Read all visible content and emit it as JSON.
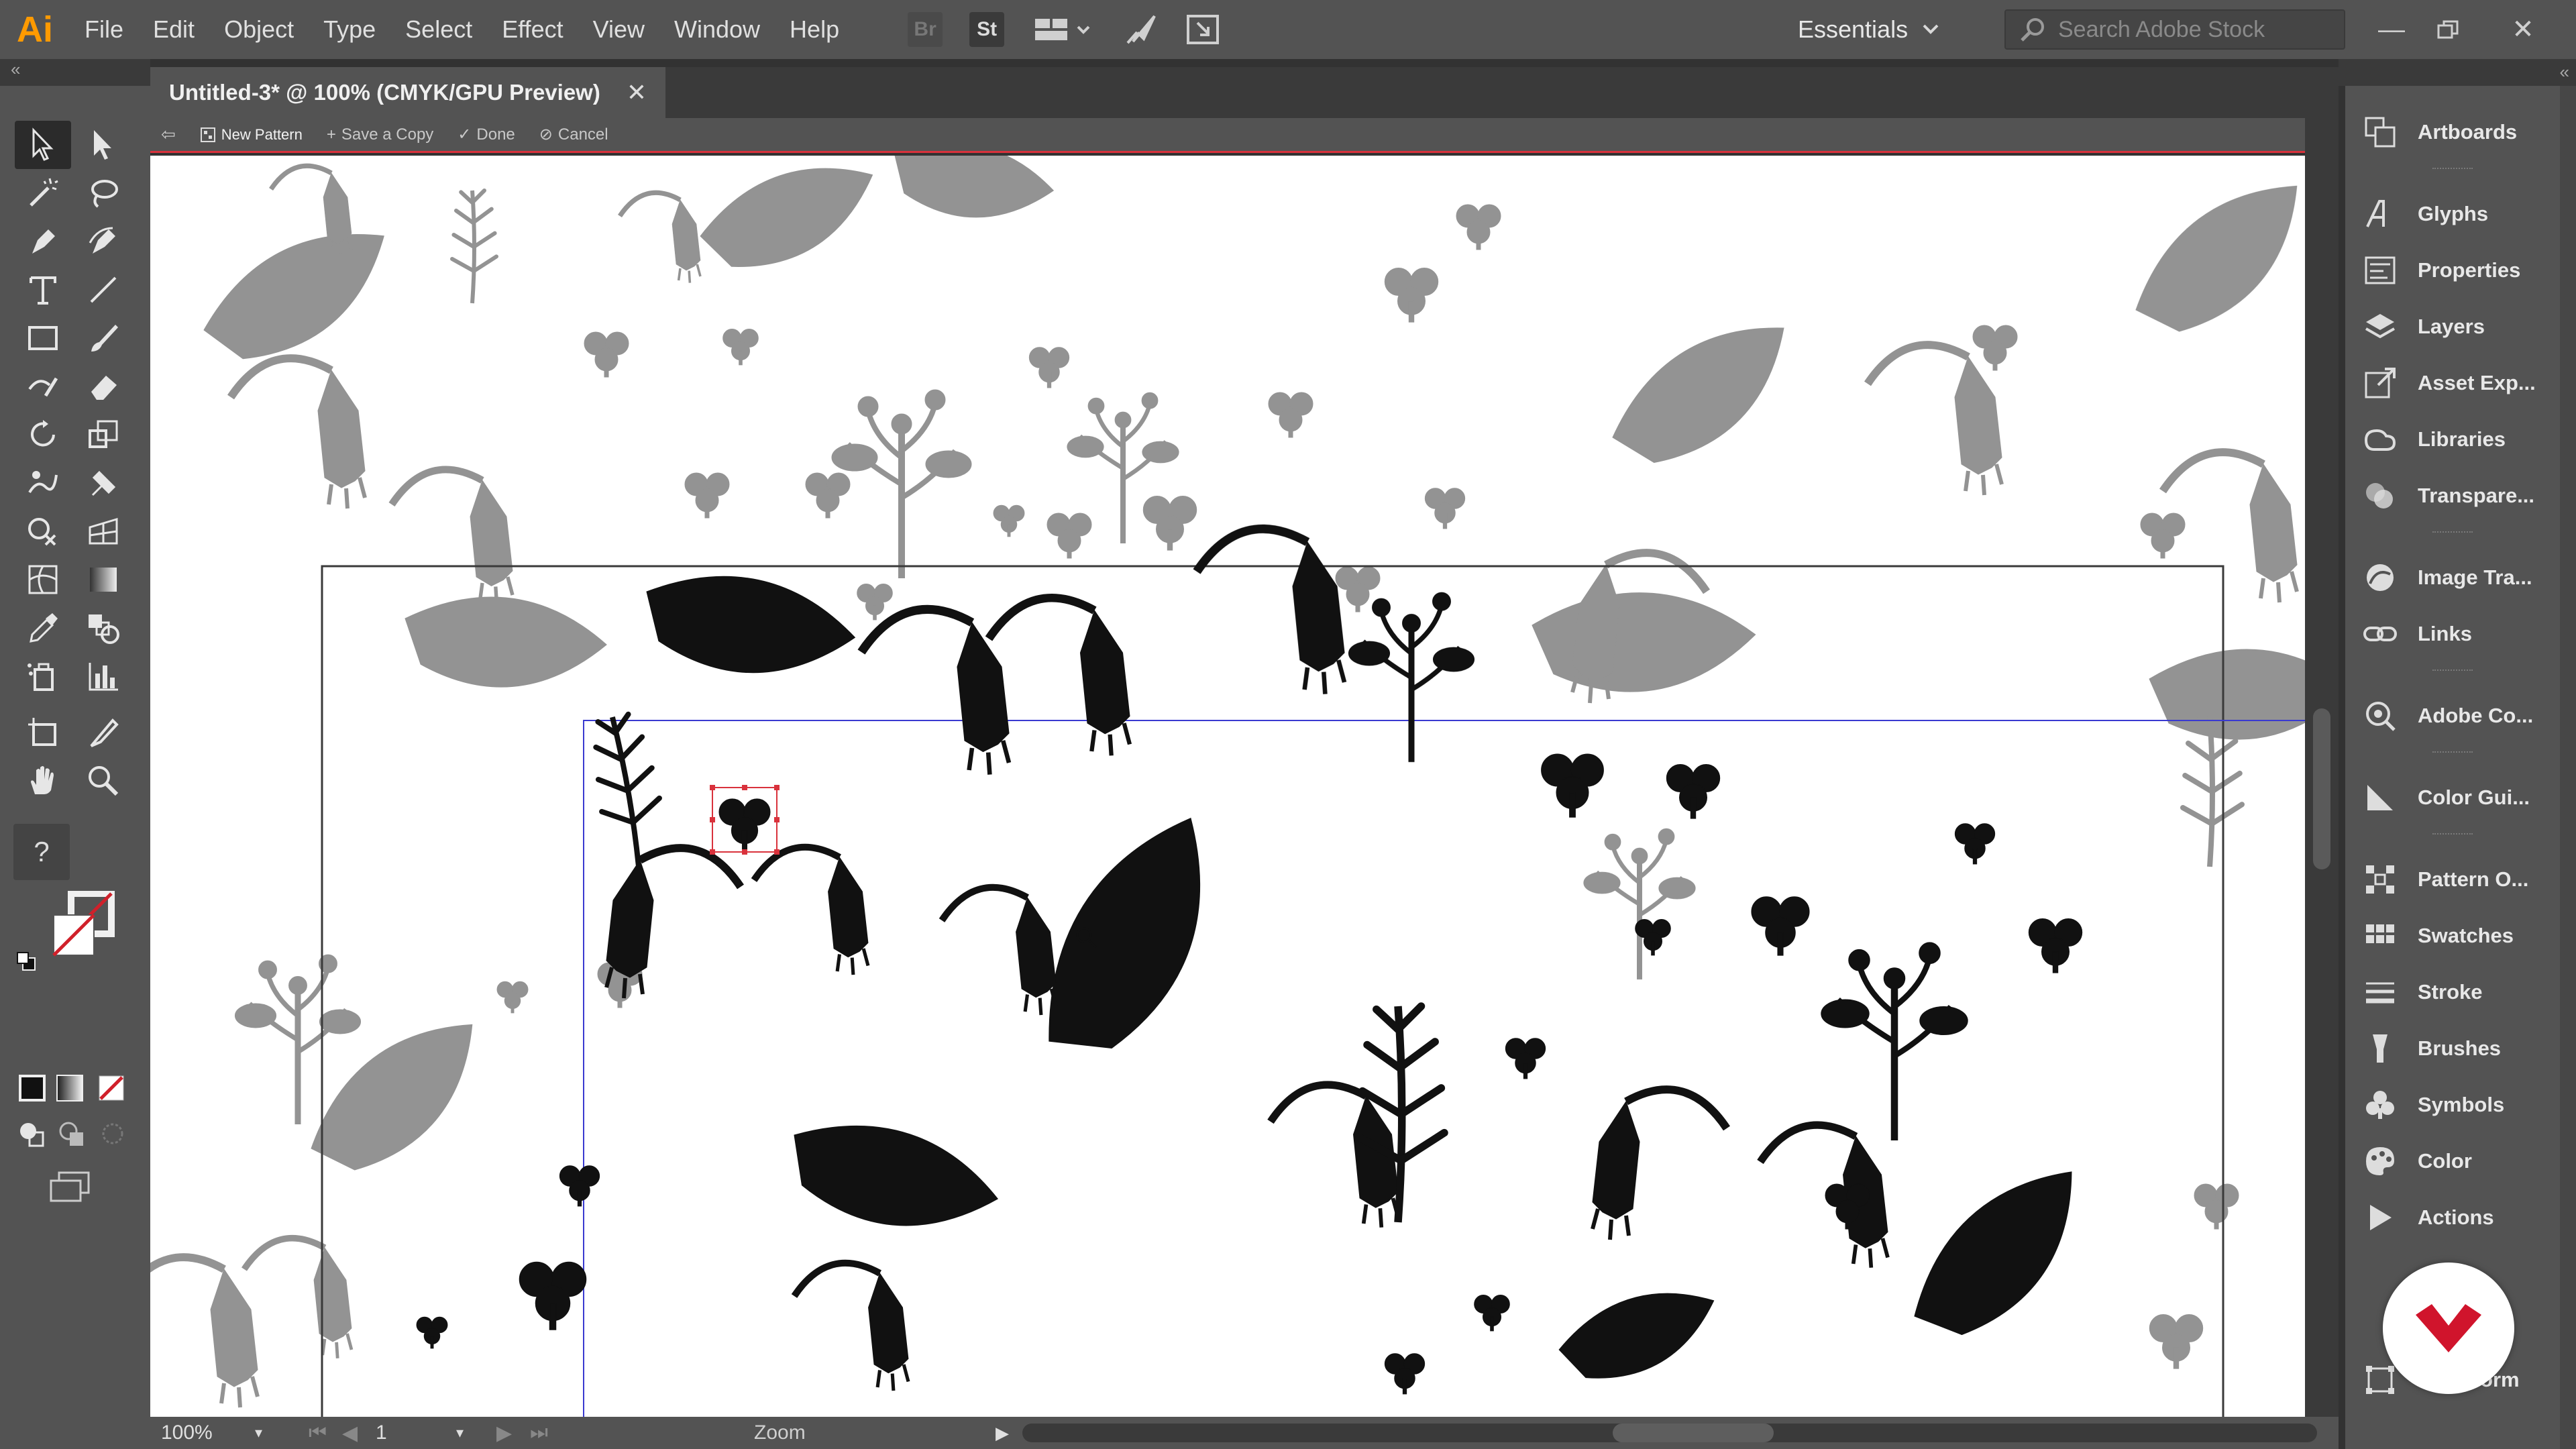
{
  "app": {
    "logo": "Ai"
  },
  "menu": [
    "File",
    "Edit",
    "Object",
    "Type",
    "Select",
    "Effect",
    "View",
    "Window",
    "Help"
  ],
  "toolbar_icons": {
    "bridge": "Br",
    "stock": "St"
  },
  "workspace": {
    "label": "Essentials"
  },
  "search": {
    "placeholder": "Search Adobe Stock"
  },
  "document": {
    "tab_title": "Untitled-3* @ 100% (CMYK/GPU Preview)"
  },
  "pattern_bar": {
    "new_pattern": "New Pattern",
    "save_copy": "Save a Copy",
    "done": "Done",
    "cancel": "Cancel"
  },
  "status": {
    "zoom": "100%",
    "artboard": "1",
    "tool": "Zoom"
  },
  "panels": [
    {
      "label": "Artboards",
      "icon": "artboards-icon"
    },
    {
      "label": "Glyphs",
      "icon": "glyphs-icon"
    },
    {
      "label": "Properties",
      "icon": "properties-icon"
    },
    {
      "label": "Layers",
      "icon": "layers-icon"
    },
    {
      "label": "Asset Exp...",
      "icon": "asset-export-icon"
    },
    {
      "label": "Libraries",
      "icon": "libraries-icon"
    },
    {
      "label": "Transpare...",
      "icon": "transparency-icon"
    },
    {
      "label": "Image Tra...",
      "icon": "image-trace-icon"
    },
    {
      "label": "Links",
      "icon": "links-icon"
    },
    {
      "label": "Adobe Co...",
      "icon": "adobe-color-icon"
    },
    {
      "label": "Color Gui...",
      "icon": "color-guide-icon"
    },
    {
      "label": "Pattern O...",
      "icon": "pattern-options-icon"
    },
    {
      "label": "Swatches",
      "icon": "swatches-icon"
    },
    {
      "label": "Stroke",
      "icon": "stroke-icon"
    },
    {
      "label": "Brushes",
      "icon": "brushes-icon"
    },
    {
      "label": "Symbols",
      "icon": "symbols-icon"
    },
    {
      "label": "Color",
      "icon": "color-icon"
    },
    {
      "label": "Actions",
      "icon": "actions-icon"
    },
    {
      "label": "Transform",
      "icon": "transform-icon"
    }
  ],
  "colors": {
    "accent_logo": "#ff9a00",
    "pattern_edge": "#d9323c",
    "tile_bound": "#3a3ad0",
    "badge": "#d0142c"
  }
}
